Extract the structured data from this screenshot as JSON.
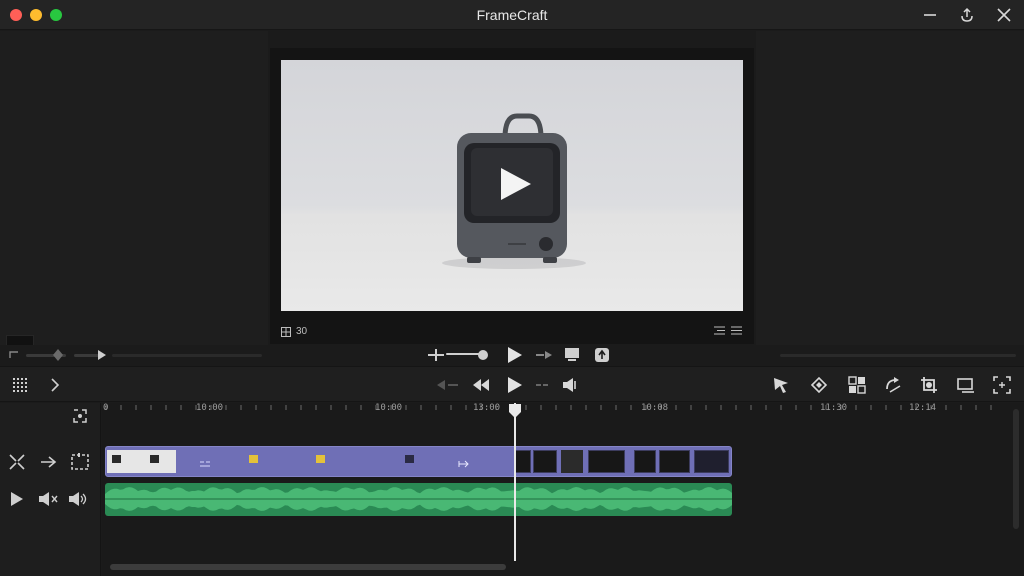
{
  "app": {
    "title": "FrameCraft"
  },
  "viewer": {
    "frame_rate": "30",
    "play_icon": "play-icon"
  },
  "colors": {
    "video_clip": "#6f6fb6",
    "audio_clip": "#2a8a54",
    "playhead": "#e9e9e9"
  },
  "timeline": {
    "ruler_labels": [
      "0",
      "10:00",
      "10:00",
      "13:00",
      "10:08",
      "11:30",
      "12:14"
    ]
  },
  "icons": {
    "window": [
      "minimize-icon",
      "share-icon",
      "close-icon"
    ],
    "toolbar_right": [
      "select-tool-icon",
      "blade-tool-icon",
      "grid-snap-icon",
      "rotate-icon",
      "crop-icon",
      "transform-icon",
      "zoom-fit-icon"
    ]
  }
}
